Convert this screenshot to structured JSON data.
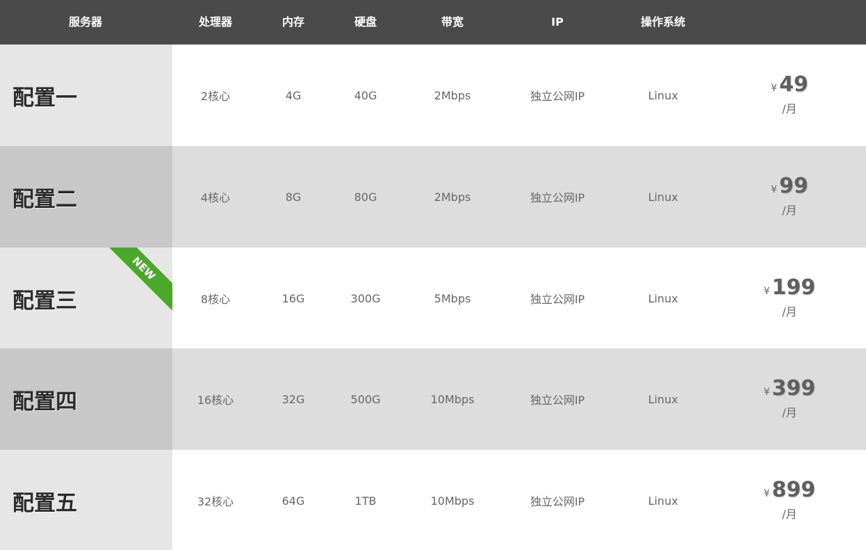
{
  "header": {
    "columns": [
      "服务器",
      "处理器",
      "内存",
      "硬盘",
      "带宽",
      "IP",
      "操作系统"
    ]
  },
  "rows": [
    {
      "name": "配置一",
      "cpu": "2核心",
      "ram": "4G",
      "disk": "40G",
      "bandwidth": "2Mbps",
      "ip": "独立公网IP",
      "os": "Linux",
      "currency": "¥",
      "price": "49",
      "period": "/月"
    },
    {
      "name": "配置二",
      "cpu": "4核心",
      "ram": "8G",
      "disk": "80G",
      "bandwidth": "2Mbps",
      "ip": "独立公网IP",
      "os": "Linux",
      "currency": "¥",
      "price": "99",
      "period": "/月"
    },
    {
      "name": "配置三",
      "cpu": "8核心",
      "ram": "16G",
      "disk": "300G",
      "bandwidth": "5Mbps",
      "ip": "独立公网IP",
      "os": "Linux",
      "currency": "¥",
      "price": "199",
      "period": "/月",
      "badge": "NEW"
    },
    {
      "name": "配置四",
      "cpu": "16核心",
      "ram": "32G",
      "disk": "500G",
      "bandwidth": "10Mbps",
      "ip": "独立公网IP",
      "os": "Linux",
      "currency": "¥",
      "price": "399",
      "period": "/月"
    },
    {
      "name": "配置五",
      "cpu": "32核心",
      "ram": "64G",
      "disk": "1TB",
      "bandwidth": "10Mbps",
      "ip": "独立公网IP",
      "os": "Linux",
      "currency": "¥",
      "price": "899",
      "period": "/月"
    }
  ],
  "colors": {
    "header_bg": "#4a4a4a",
    "badge_bg": "#4aa82a",
    "row_alt_bg": "#dddddd"
  }
}
